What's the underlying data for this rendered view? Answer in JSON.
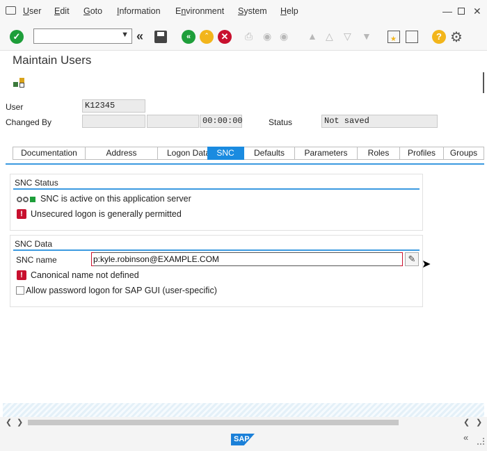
{
  "menu": {
    "items": [
      {
        "pre": "",
        "u": "U",
        "post": "ser"
      },
      {
        "pre": "",
        "u": "E",
        "post": "dit"
      },
      {
        "pre": "",
        "u": "G",
        "post": "oto"
      },
      {
        "pre": "",
        "u": "I",
        "post": "nformation"
      },
      {
        "pre": "E",
        "u": "n",
        "post": "vironment"
      },
      {
        "pre": "",
        "u": "S",
        "post": "ystem"
      },
      {
        "pre": "",
        "u": "H",
        "post": "elp"
      }
    ]
  },
  "title": "Maintain Users",
  "header": {
    "user_label": "User",
    "user_value": "K12345",
    "changed_by_label": "Changed By",
    "changed_by_value": "",
    "changed_date": "",
    "changed_time": "00:00:00",
    "status_label": "Status",
    "status_value": "Not saved"
  },
  "tabs": [
    "Documentation",
    "Address",
    "Logon Data",
    "SNC",
    "Defaults",
    "Parameters",
    "Roles",
    "Profiles",
    "Groups"
  ],
  "active_tab": "SNC",
  "snc_status": {
    "title": "SNC Status",
    "line1": "SNC is active on this application server",
    "line2": "Unsecured logon is generally permitted"
  },
  "snc_data": {
    "title": "SNC Data",
    "name_label": "SNC name",
    "name_value": "p:kyle.robinson@EXAMPLE.COM",
    "warning": "Canonical name not defined",
    "checkbox_label": "Allow password logon for SAP GUI (user-specific)"
  },
  "logo": "SAP",
  "colors": {
    "accent": "#1a8be0",
    "error": "#c8102e",
    "ok_green": "#1e9e3a",
    "nav_yellow": "#f2b51b"
  }
}
